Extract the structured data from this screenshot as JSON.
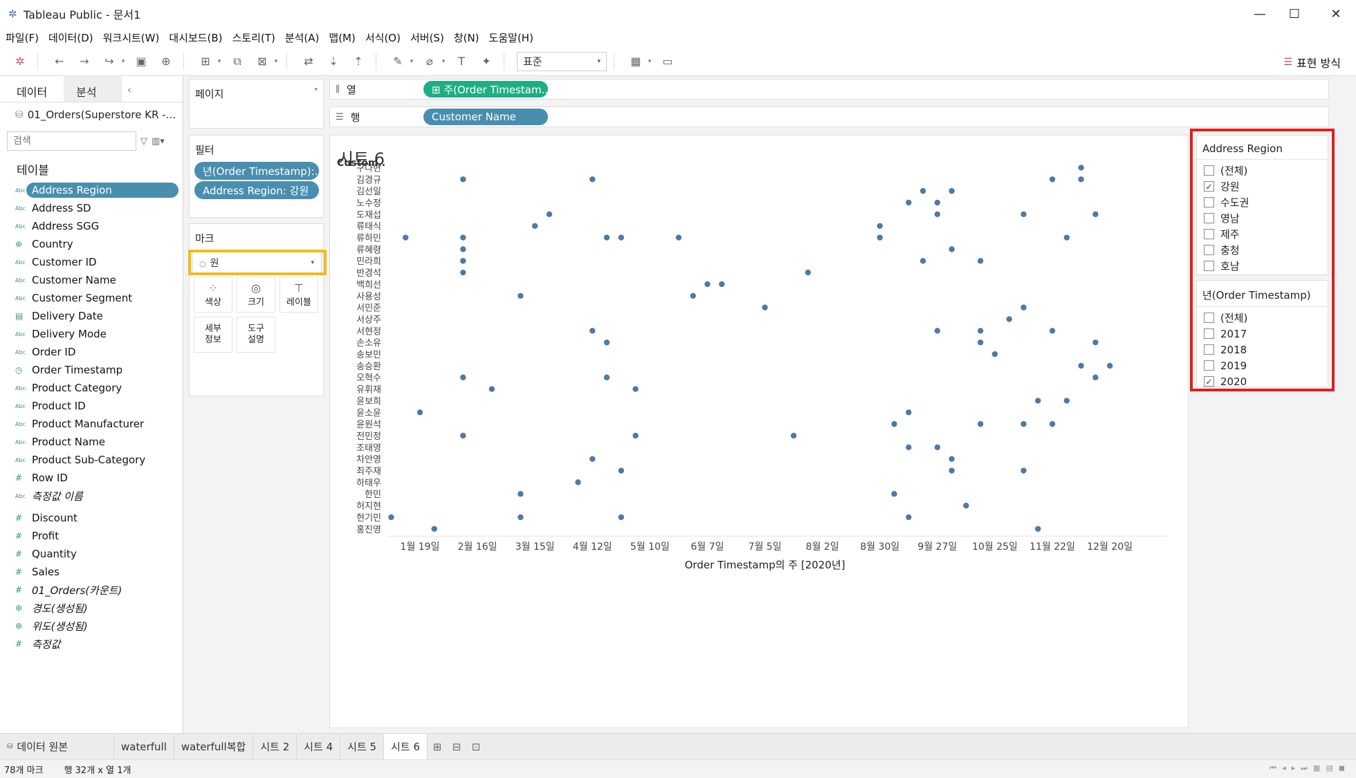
{
  "window": {
    "title": "Tableau Public - 문서1",
    "minimize": "—",
    "maximize": "☐",
    "close": "✕"
  },
  "menu": [
    "파일(F)",
    "데이터(D)",
    "워크시트(W)",
    "대시보드(B)",
    "스토리(T)",
    "분석(A)",
    "맵(M)",
    "서식(O)",
    "서버(S)",
    "창(N)",
    "도움말(H)"
  ],
  "toolbar": {
    "fit": "표준",
    "show_me": "표현 방식"
  },
  "data_pane": {
    "tab_data": "데이터",
    "tab_analysis": "분석",
    "collapse": "‹",
    "datasource": "01_Orders(Superstore KR -...",
    "search_placeholder": "검색",
    "tables_label": "테이블",
    "fields": [
      {
        "type": "Abc",
        "name": "Address Region",
        "selected": true
      },
      {
        "type": "Abc",
        "name": "Address SD"
      },
      {
        "type": "Abc",
        "name": "Address SGG"
      },
      {
        "type": "geo",
        "name": "Country"
      },
      {
        "type": "Abc",
        "name": "Customer ID"
      },
      {
        "type": "Abc",
        "name": "Customer Name"
      },
      {
        "type": "Abc",
        "name": "Customer Segment"
      },
      {
        "type": "date",
        "name": "Delivery Date"
      },
      {
        "type": "Abc",
        "name": "Delivery Mode"
      },
      {
        "type": "Abc",
        "name": "Order ID"
      },
      {
        "type": "datetime",
        "name": "Order Timestamp"
      },
      {
        "type": "Abc",
        "name": "Product Category"
      },
      {
        "type": "Abc",
        "name": "Product ID"
      },
      {
        "type": "Abc",
        "name": "Product Manufacturer"
      },
      {
        "type": "Abc",
        "name": "Product Name"
      },
      {
        "type": "Abc",
        "name": "Product Sub-Category"
      },
      {
        "type": "#",
        "name": "Row ID"
      },
      {
        "type": "Abc",
        "name": "측정값 이름",
        "italic": true
      }
    ],
    "measures": [
      {
        "type": "#",
        "name": "Discount"
      },
      {
        "type": "#",
        "name": "Profit"
      },
      {
        "type": "#",
        "name": "Quantity"
      },
      {
        "type": "#",
        "name": "Sales"
      },
      {
        "type": "#",
        "name": "01_Orders(카운트)",
        "italic": true
      },
      {
        "type": "geo",
        "name": "경도(생성됨)",
        "italic": true
      },
      {
        "type": "geo",
        "name": "위도(생성됨)",
        "italic": true
      },
      {
        "type": "#",
        "name": "측정값",
        "italic": true
      }
    ]
  },
  "shelves": {
    "pages_label": "페이지",
    "filters_label": "필터",
    "filters": [
      "년(Order Timestamp):...",
      "Address Region: 강원"
    ],
    "marks_label": "마크",
    "mark_type": "원",
    "mark_buttons": [
      "색상",
      "크기",
      "레이블",
      "세부\n정보",
      "도구\n설명"
    ],
    "columns_label": "열",
    "columns_pill": "⊞ 주(Order Timestam..",
    "rows_label": "행",
    "rows_pill": "Customer Name"
  },
  "sheet": {
    "title": "시트 6"
  },
  "chart_data": {
    "type": "scatter",
    "title": "시트 6",
    "xlabel": "Order Timestamp의 주 [2020년]",
    "ylabel": "Custom..",
    "x_ticks": [
      "1월 19일",
      "2월 16일",
      "3월 15일",
      "4월 12일",
      "5월 10일",
      "6월 7일",
      "7월 5일",
      "8월 2일",
      "8월 30일",
      "9월 27일",
      "10월 25일",
      "11월 22일",
      "12월 20일"
    ],
    "x_range_weeks": [
      0,
      52
    ],
    "categories": [
      "구다현",
      "김경규",
      "김선일",
      "노수정",
      "도재섭",
      "류태식",
      "류하민",
      "류혜령",
      "민라희",
      "반경석",
      "백희선",
      "사용성",
      "서민준",
      "서상주",
      "서현정",
      "손소유",
      "송보민",
      "송승환",
      "오혁수",
      "유휘재",
      "윤보희",
      "윤소윤",
      "윤원석",
      "전민정",
      "조태영",
      "차안영",
      "최주재",
      "하태우",
      "한민",
      "허지현",
      "현기민",
      "홍진영"
    ],
    "points_week": [
      [
        0,
        48.5
      ],
      [
        1,
        5.5
      ],
      [
        1,
        14.5
      ],
      [
        1,
        46.5
      ],
      [
        1,
        48.5
      ],
      [
        2,
        37.5
      ],
      [
        2,
        39.5
      ],
      [
        3,
        36.5
      ],
      [
        3,
        38.5
      ],
      [
        4,
        11.5
      ],
      [
        4,
        38.5
      ],
      [
        4,
        44.5
      ],
      [
        4,
        49.5
      ],
      [
        5,
        10.5
      ],
      [
        5,
        34.5
      ],
      [
        6,
        1.5
      ],
      [
        6,
        5.5
      ],
      [
        6,
        15.5
      ],
      [
        6,
        16.5
      ],
      [
        6,
        20.5
      ],
      [
        6,
        34.5
      ],
      [
        6,
        47.5
      ],
      [
        7,
        5.5
      ],
      [
        7,
        39.5
      ],
      [
        8,
        5.5
      ],
      [
        8,
        37.5
      ],
      [
        8,
        41.5
      ],
      [
        9,
        5.5
      ],
      [
        9,
        29.5
      ],
      [
        10,
        22.5
      ],
      [
        10,
        23.5
      ],
      [
        11,
        9.5
      ],
      [
        11,
        21.5
      ],
      [
        12,
        26.5
      ],
      [
        12,
        44.5
      ],
      [
        13,
        43.5
      ],
      [
        14,
        14.5
      ],
      [
        14,
        38.5
      ],
      [
        14,
        41.5
      ],
      [
        14,
        46.5
      ],
      [
        15,
        15.5
      ],
      [
        15,
        41.5
      ],
      [
        15,
        49.5
      ],
      [
        16,
        42.5
      ],
      [
        17,
        48.5
      ],
      [
        17,
        50.5
      ],
      [
        18,
        5.5
      ],
      [
        18,
        15.5
      ],
      [
        18,
        49.5
      ],
      [
        19,
        7.5
      ],
      [
        19,
        17.5
      ],
      [
        20,
        45.5
      ],
      [
        20,
        47.5
      ],
      [
        21,
        2.5
      ],
      [
        21,
        36.5
      ],
      [
        22,
        35.5
      ],
      [
        22,
        41.5
      ],
      [
        22,
        44.5
      ],
      [
        22,
        46.5
      ],
      [
        23,
        5.5
      ],
      [
        23,
        17.5
      ],
      [
        23,
        28.5
      ],
      [
        24,
        36.5
      ],
      [
        24,
        38.5
      ],
      [
        25,
        14.5
      ],
      [
        25,
        39.5
      ],
      [
        26,
        16.5
      ],
      [
        26,
        39.5
      ],
      [
        26,
        44.5
      ],
      [
        27,
        13.5
      ],
      [
        28,
        9.5
      ],
      [
        28,
        35.5
      ],
      [
        29,
        40.5
      ],
      [
        30,
        0.5
      ],
      [
        30,
        9.5
      ],
      [
        30,
        16.5
      ],
      [
        30,
        36.5
      ],
      [
        31,
        3.5
      ],
      [
        31,
        45.5
      ]
    ]
  },
  "quick_filters": {
    "region": {
      "title": "Address Region",
      "items": [
        {
          "label": "(전체)",
          "checked": false
        },
        {
          "label": "강원",
          "checked": true
        },
        {
          "label": "수도권",
          "checked": false
        },
        {
          "label": "영남",
          "checked": false
        },
        {
          "label": "제주",
          "checked": false
        },
        {
          "label": "충청",
          "checked": false
        },
        {
          "label": "호남",
          "checked": false
        }
      ]
    },
    "year": {
      "title": "년(Order Timestamp)",
      "items": [
        {
          "label": "(전체)",
          "checked": false
        },
        {
          "label": "2017",
          "checked": false
        },
        {
          "label": "2018",
          "checked": false
        },
        {
          "label": "2019",
          "checked": false
        },
        {
          "label": "2020",
          "checked": true
        }
      ]
    }
  },
  "tabs": {
    "datasource": "데이터 원본",
    "sheets": [
      {
        "label": "waterfull",
        "active": false
      },
      {
        "label": "waterfull복합",
        "active": false
      },
      {
        "label": "시트 2",
        "active": false
      },
      {
        "label": "시트 4",
        "active": false
      },
      {
        "label": "시트 5",
        "active": false
      },
      {
        "label": "시트 6",
        "active": true
      }
    ]
  },
  "status": {
    "marks": "78개 마크",
    "dims": "행 32개 x 열 1개"
  },
  "colors": {
    "mark": "#4e79a7",
    "pill_blue": "#4a8eaf",
    "pill_green": "#1fae84",
    "highlight_red": "#e51c1c",
    "highlight_yellow": "#f1bc17"
  }
}
